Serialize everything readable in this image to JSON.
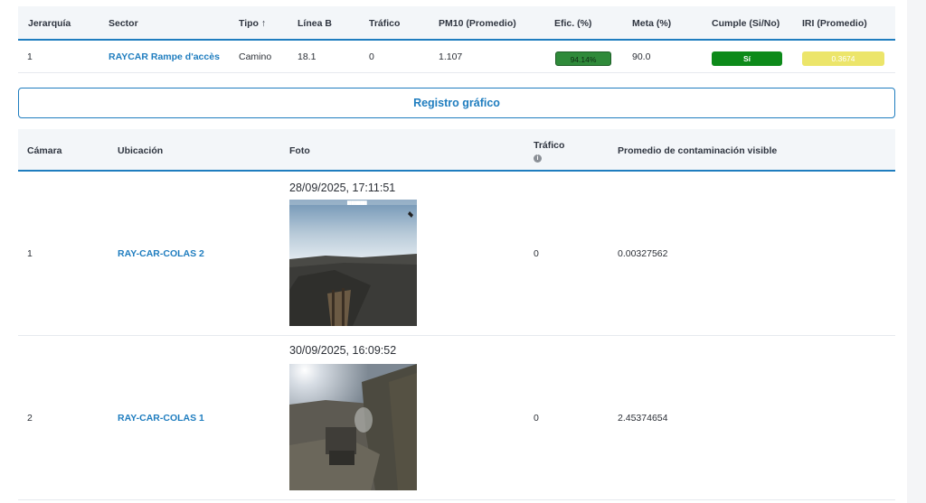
{
  "summary_table": {
    "headers": [
      "Jerarquía",
      "Sector",
      "Tipo",
      "Línea B",
      "Tráfico",
      "PM10 (Promedio)",
      "Efic. (%)",
      "Meta (%)",
      "Cumple (Si/No)",
      "IRI (Promedio)"
    ],
    "sort_indicator": "↑",
    "row": {
      "jerarquia": "1",
      "sector": "RAYCAR Rampe d'accès",
      "tipo": "Camino",
      "linea_b": "18.1",
      "trafico": "0",
      "pm10": "1.107",
      "efic": "94.14%",
      "meta": "90.0",
      "cumple": "Sí",
      "iri": "0.3674"
    },
    "colors": {
      "efic_bg": "#2f8a3a",
      "cumple_bg": "#0d8a1a",
      "iri_bg": "#ece56a"
    }
  },
  "registro_button": {
    "label": "Registro gráfico"
  },
  "camera_table": {
    "headers": {
      "camara": "Cámara",
      "ubicacion": "Ubicación",
      "foto": "Foto",
      "trafico": "Tráfico",
      "promedio": "Promedio de contaminación visible"
    },
    "info_icon": "info-icon",
    "rows": [
      {
        "camara": "1",
        "ubicacion": "RAY-CAR-COLAS 2",
        "timestamp": "28/09/2025, 17:11:51",
        "trafico": "0",
        "promedio": "0.00327562"
      },
      {
        "camara": "2",
        "ubicacion": "RAY-CAR-COLAS 1",
        "timestamp": "30/09/2025, 16:09:52",
        "trafico": "0",
        "promedio": "2.45374654"
      }
    ]
  }
}
